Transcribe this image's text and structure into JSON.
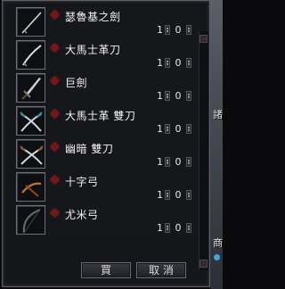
{
  "shop": {
    "items": [
      {
        "name": "瑟魯基之劍",
        "quantity": "1",
        "value": "0",
        "icon": "long-sword-icon"
      },
      {
        "name": "大馬士革刀",
        "quantity": "1",
        "value": "0",
        "icon": "damascus-blade-icon"
      },
      {
        "name": "巨劍",
        "quantity": "1",
        "value": "0",
        "icon": "greatsword-icon"
      },
      {
        "name": "大馬士革 雙刀",
        "quantity": "1",
        "value": "0",
        "icon": "damascus-dual-blades-icon"
      },
      {
        "name": "幽暗 雙刀",
        "quantity": "1",
        "value": "0",
        "icon": "dark-dual-blades-icon"
      },
      {
        "name": "十字弓",
        "quantity": "1",
        "value": "0",
        "icon": "crossbow-icon"
      },
      {
        "name": "尤米弓",
        "quantity": "1",
        "value": "0",
        "icon": "yumi-bow-icon"
      }
    ],
    "buy_label": "買",
    "cancel_label": "取消"
  },
  "world": {
    "char_top": "諸",
    "char_bottom": "商"
  },
  "colors": {
    "panel_bg": "#15161a",
    "border": "#5d5e66",
    "marker": "#7a1515",
    "text": "#f2f2f2"
  }
}
